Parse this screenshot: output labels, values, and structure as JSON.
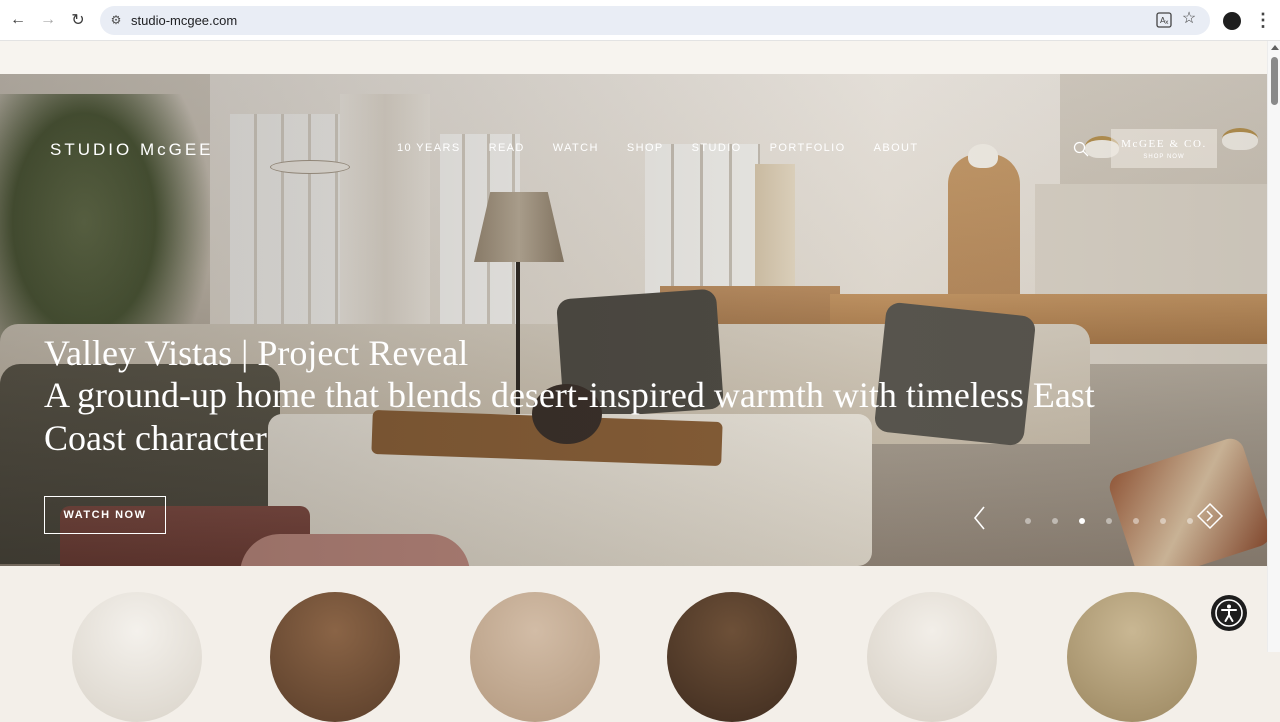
{
  "browser": {
    "url": "studio-mcgee.com"
  },
  "site": {
    "logo": "STUDIO McGEE",
    "nav": [
      {
        "label": "10 YEARS"
      },
      {
        "label": "READ"
      },
      {
        "label": "WATCH"
      },
      {
        "label": "SHOP"
      },
      {
        "label": "STUDIO"
      },
      {
        "label": "PORTFOLIO"
      },
      {
        "label": "ABOUT"
      }
    ],
    "shop_button": {
      "title": "McGEE & CO.",
      "subtitle": "SHOP NOW"
    }
  },
  "hero": {
    "title": "Valley Vistas | Project Reveal",
    "subtitle": "A ground-up home that blends desert-inspired warmth with timeless East Coast character",
    "cta": "WATCH NOW",
    "carousel": {
      "slide_count": 7,
      "active_index": 2
    }
  },
  "colors": {
    "page_background": "#f3efe9",
    "text_on_hero": "#ffffff",
    "accessibility_button": "#1d1d1d"
  },
  "icons": {
    "back": "back-arrow-icon",
    "forward": "forward-arrow-icon",
    "reload": "reload-icon",
    "site_info": "site-settings-icon",
    "translate": "translate-icon",
    "bookmark": "star-icon",
    "search": "search-icon",
    "carousel_prev": "chevron-left-icon",
    "carousel_next": "diamond-arrow-icon",
    "accessibility": "accessibility-icon"
  }
}
